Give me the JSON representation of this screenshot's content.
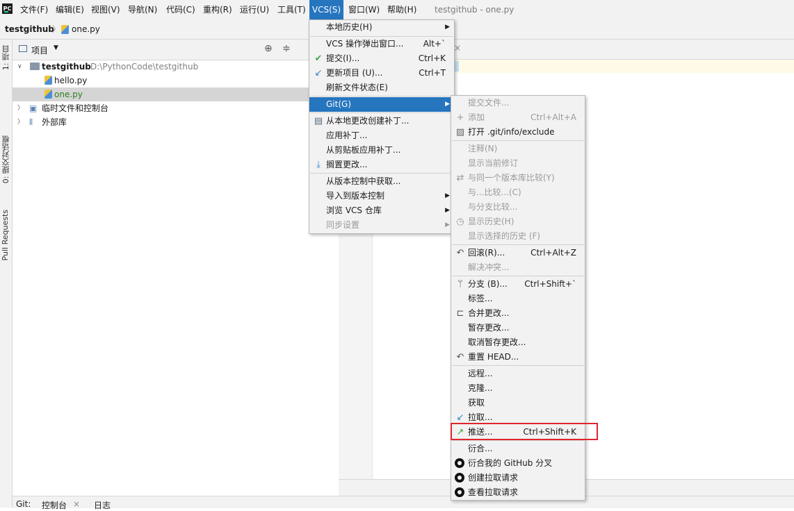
{
  "menubar": {
    "logo": "PC",
    "items": [
      "文件(F)",
      "编辑(E)",
      "视图(V)",
      "导航(N)",
      "代码(C)",
      "重构(R)",
      "运行(U)",
      "工具(T)",
      "VCS(S)",
      "窗口(W)",
      "帮助(H)"
    ],
    "window_title": "testgithub - one.py"
  },
  "breadcrumb": {
    "project": "testgithub",
    "file": "one.py"
  },
  "left_strip": {
    "tabs": [
      "1: 项目",
      "0: 提交对话框",
      "Pull Requests"
    ]
  },
  "project_panel": {
    "title": "项目",
    "tree": [
      {
        "label": "testgithub",
        "path": "D:\\PythonCode\\testgithub"
      },
      {
        "label": "hello.py"
      },
      {
        "label": "one.py"
      },
      {
        "label": "临时文件和控制台"
      },
      {
        "label": "外部库"
      }
    ]
  },
  "vcs_menu": {
    "items": [
      {
        "label": "本地历史(H)",
        "shortcut": ""
      },
      {
        "label": "VCS 操作弹出窗口...",
        "shortcut": "Alt+`"
      },
      {
        "label": "提交(I)...",
        "shortcut": "Ctrl+K"
      },
      {
        "label": "更新项目 (U)...",
        "shortcut": "Ctrl+T"
      },
      {
        "label": "刷新文件状态(E)",
        "shortcut": ""
      },
      {
        "label": "Git(G)",
        "shortcut": ""
      },
      {
        "label": "从本地更改创建补丁...",
        "shortcut": ""
      },
      {
        "label": "应用补丁...",
        "shortcut": ""
      },
      {
        "label": "从剪贴板应用补丁...",
        "shortcut": ""
      },
      {
        "label": "搁置更改...",
        "shortcut": ""
      },
      {
        "label": "从版本控制中获取...",
        "shortcut": ""
      },
      {
        "label": "导入到版本控制",
        "shortcut": ""
      },
      {
        "label": "浏览 VCS 仓库",
        "shortcut": ""
      },
      {
        "label": "同步设置",
        "shortcut": ""
      }
    ]
  },
  "git_menu": {
    "items": [
      {
        "label": "提交文件...",
        "shortcut": ""
      },
      {
        "label": "添加",
        "shortcut": "Ctrl+Alt+A"
      },
      {
        "label": "打开 .git/info/exclude",
        "shortcut": ""
      },
      {
        "label": "注释(N)",
        "shortcut": ""
      },
      {
        "label": "显示当前修订",
        "shortcut": ""
      },
      {
        "label": "与同一个版本库比较(Y)",
        "shortcut": ""
      },
      {
        "label": "与...比较...(C)",
        "shortcut": ""
      },
      {
        "label": "与分支比较...",
        "shortcut": ""
      },
      {
        "label": "显示历史(H)",
        "shortcut": ""
      },
      {
        "label": "显示选择的历史 (F)",
        "shortcut": ""
      },
      {
        "label": "回滚(R)...",
        "shortcut": "Ctrl+Alt+Z"
      },
      {
        "label": "解决冲突...",
        "shortcut": ""
      },
      {
        "label": "分支 (B)...",
        "shortcut": "Ctrl+Shift+`"
      },
      {
        "label": "标签...",
        "shortcut": ""
      },
      {
        "label": "合并更改...",
        "shortcut": ""
      },
      {
        "label": "暂存更改...",
        "shortcut": ""
      },
      {
        "label": "取消暂存更改...",
        "shortcut": ""
      },
      {
        "label": "重置 HEAD...",
        "shortcut": ""
      },
      {
        "label": "远程...",
        "shortcut": ""
      },
      {
        "label": "克隆...",
        "shortcut": ""
      },
      {
        "label": "获取",
        "shortcut": ""
      },
      {
        "label": "拉取...",
        "shortcut": ""
      },
      {
        "label": "推送...",
        "shortcut": "Ctrl+Shift+K"
      },
      {
        "label": "衍合...",
        "shortcut": ""
      },
      {
        "label": "衍合我的 GitHub 分叉",
        "shortcut": ""
      },
      {
        "label": "创建拉取请求",
        "shortcut": ""
      },
      {
        "label": "查看拉取请求",
        "shortcut": ""
      }
    ]
  },
  "bottom_bar": {
    "tabs": [
      "Git:",
      "控制台",
      "日志"
    ]
  },
  "colors": {
    "accent": "#2675bf",
    "highlight_box": "#e0262d",
    "selected_row": "#d5d5d5"
  }
}
